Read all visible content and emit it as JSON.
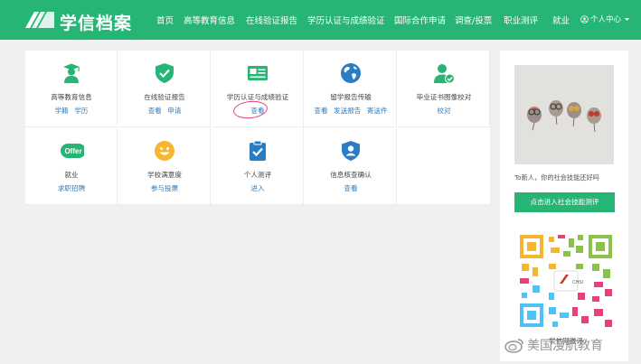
{
  "header": {
    "logo_text": "学信档案",
    "nav": [
      "首页",
      "高等教育信息",
      "在线验证报告",
      "学历认证与成绩验证",
      "国际合作申请",
      "调查/投票",
      "职业测评",
      "就业"
    ],
    "user_menu": "个人中心",
    "colors": {
      "brand": "#27b575",
      "link": "#2a7dc4",
      "annotation": "#e8407c"
    }
  },
  "services": [
    {
      "title": "高等教育信息",
      "icon": "graduate-icon",
      "links": [
        "学籍",
        "学历"
      ]
    },
    {
      "title": "在线验证报告",
      "icon": "shield-check-icon",
      "links": [
        "查看",
        "申请"
      ]
    },
    {
      "title": "学历认证与成绩验证",
      "icon": "id-card-icon",
      "links": [
        "查看"
      ]
    },
    {
      "title": "留学报告传输",
      "icon": "globe-icon",
      "links": [
        "查看",
        "发送报告",
        "寄送件"
      ]
    },
    {
      "title": "毕业证书图像校对",
      "icon": "user-check-icon",
      "links": [
        "校对"
      ]
    },
    {
      "title": "就业",
      "icon": "offer-badge-icon",
      "badge": "Offer",
      "links": [
        "求职招聘"
      ]
    },
    {
      "title": "学校满意度",
      "icon": "smiley-icon",
      "links": [
        "参与投票"
      ]
    },
    {
      "title": "个人测评",
      "icon": "clipboard-check-icon",
      "links": [
        "进入"
      ]
    },
    {
      "title": "信息核查确认",
      "icon": "user-shield-icon",
      "links": [
        "查看"
      ]
    }
  ],
  "sidebar": {
    "promo_caption": "To新人，你的社会技能还好吗",
    "promo_button": "点击进入社会技能测评",
    "qr_caption": "学信网微评",
    "qr_center_label": "CHSI"
  },
  "watermark": {
    "text": "美国漫航教育"
  }
}
